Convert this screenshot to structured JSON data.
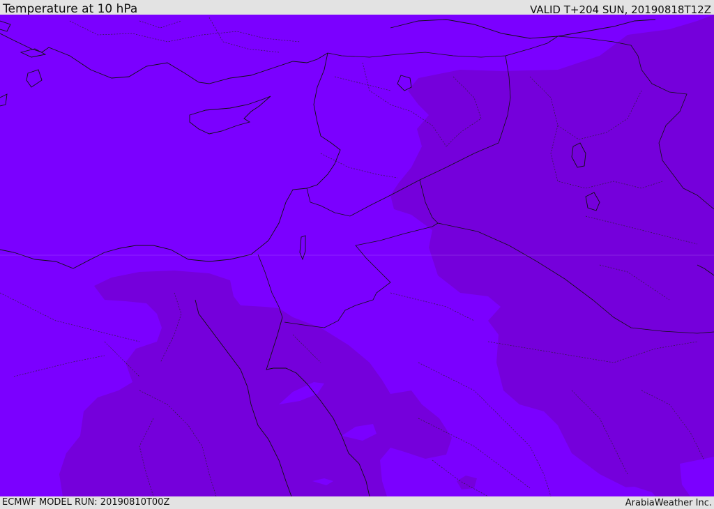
{
  "header": {
    "title": "Temperature at 10 hPa",
    "valid": "VALID T+204 SUN, 20190818T12Z"
  },
  "footer": {
    "model_run": "ECMWF MODEL RUN: 20190810T00Z",
    "credit": "ArabiaWeather Inc."
  },
  "map": {
    "field": "temperature",
    "level": "10 hPa",
    "colors": {
      "warmer_band": "#7b00ff",
      "colder_band": "#7500db",
      "coastline": "#000000",
      "border": "#222222"
    }
  }
}
